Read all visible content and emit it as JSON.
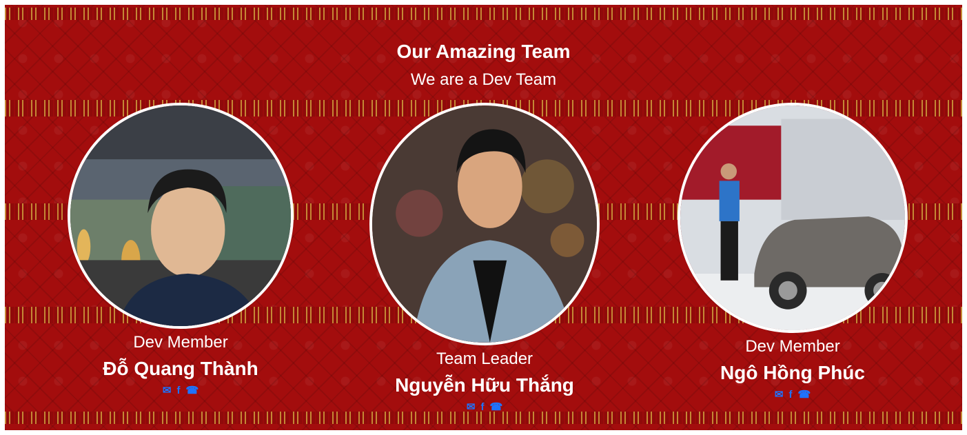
{
  "section": {
    "title": "Our Amazing Team",
    "subtitle": "We are a Dev Team"
  },
  "members": [
    {
      "role": "Dev Member",
      "name": "Đỗ Quang Thành",
      "photo_icon": "person-photo",
      "socials": [
        "email-icon",
        "facebook-icon",
        "phone-icon"
      ]
    },
    {
      "role": "Team Leader",
      "name": "Nguyễn Hữu Thắng",
      "photo_icon": "person-photo",
      "socials": [
        "email-icon",
        "facebook-icon",
        "phone-icon"
      ]
    },
    {
      "role": "Dev Member",
      "name": "Ngô Hồng Phúc",
      "photo_icon": "person-with-car-photo",
      "socials": [
        "email-icon",
        "facebook-icon",
        "phone-icon"
      ]
    }
  ],
  "colors": {
    "background": "#a30d0d",
    "text": "#ffffff",
    "social_icon": "#1e74ff",
    "border": "#ffffff"
  }
}
